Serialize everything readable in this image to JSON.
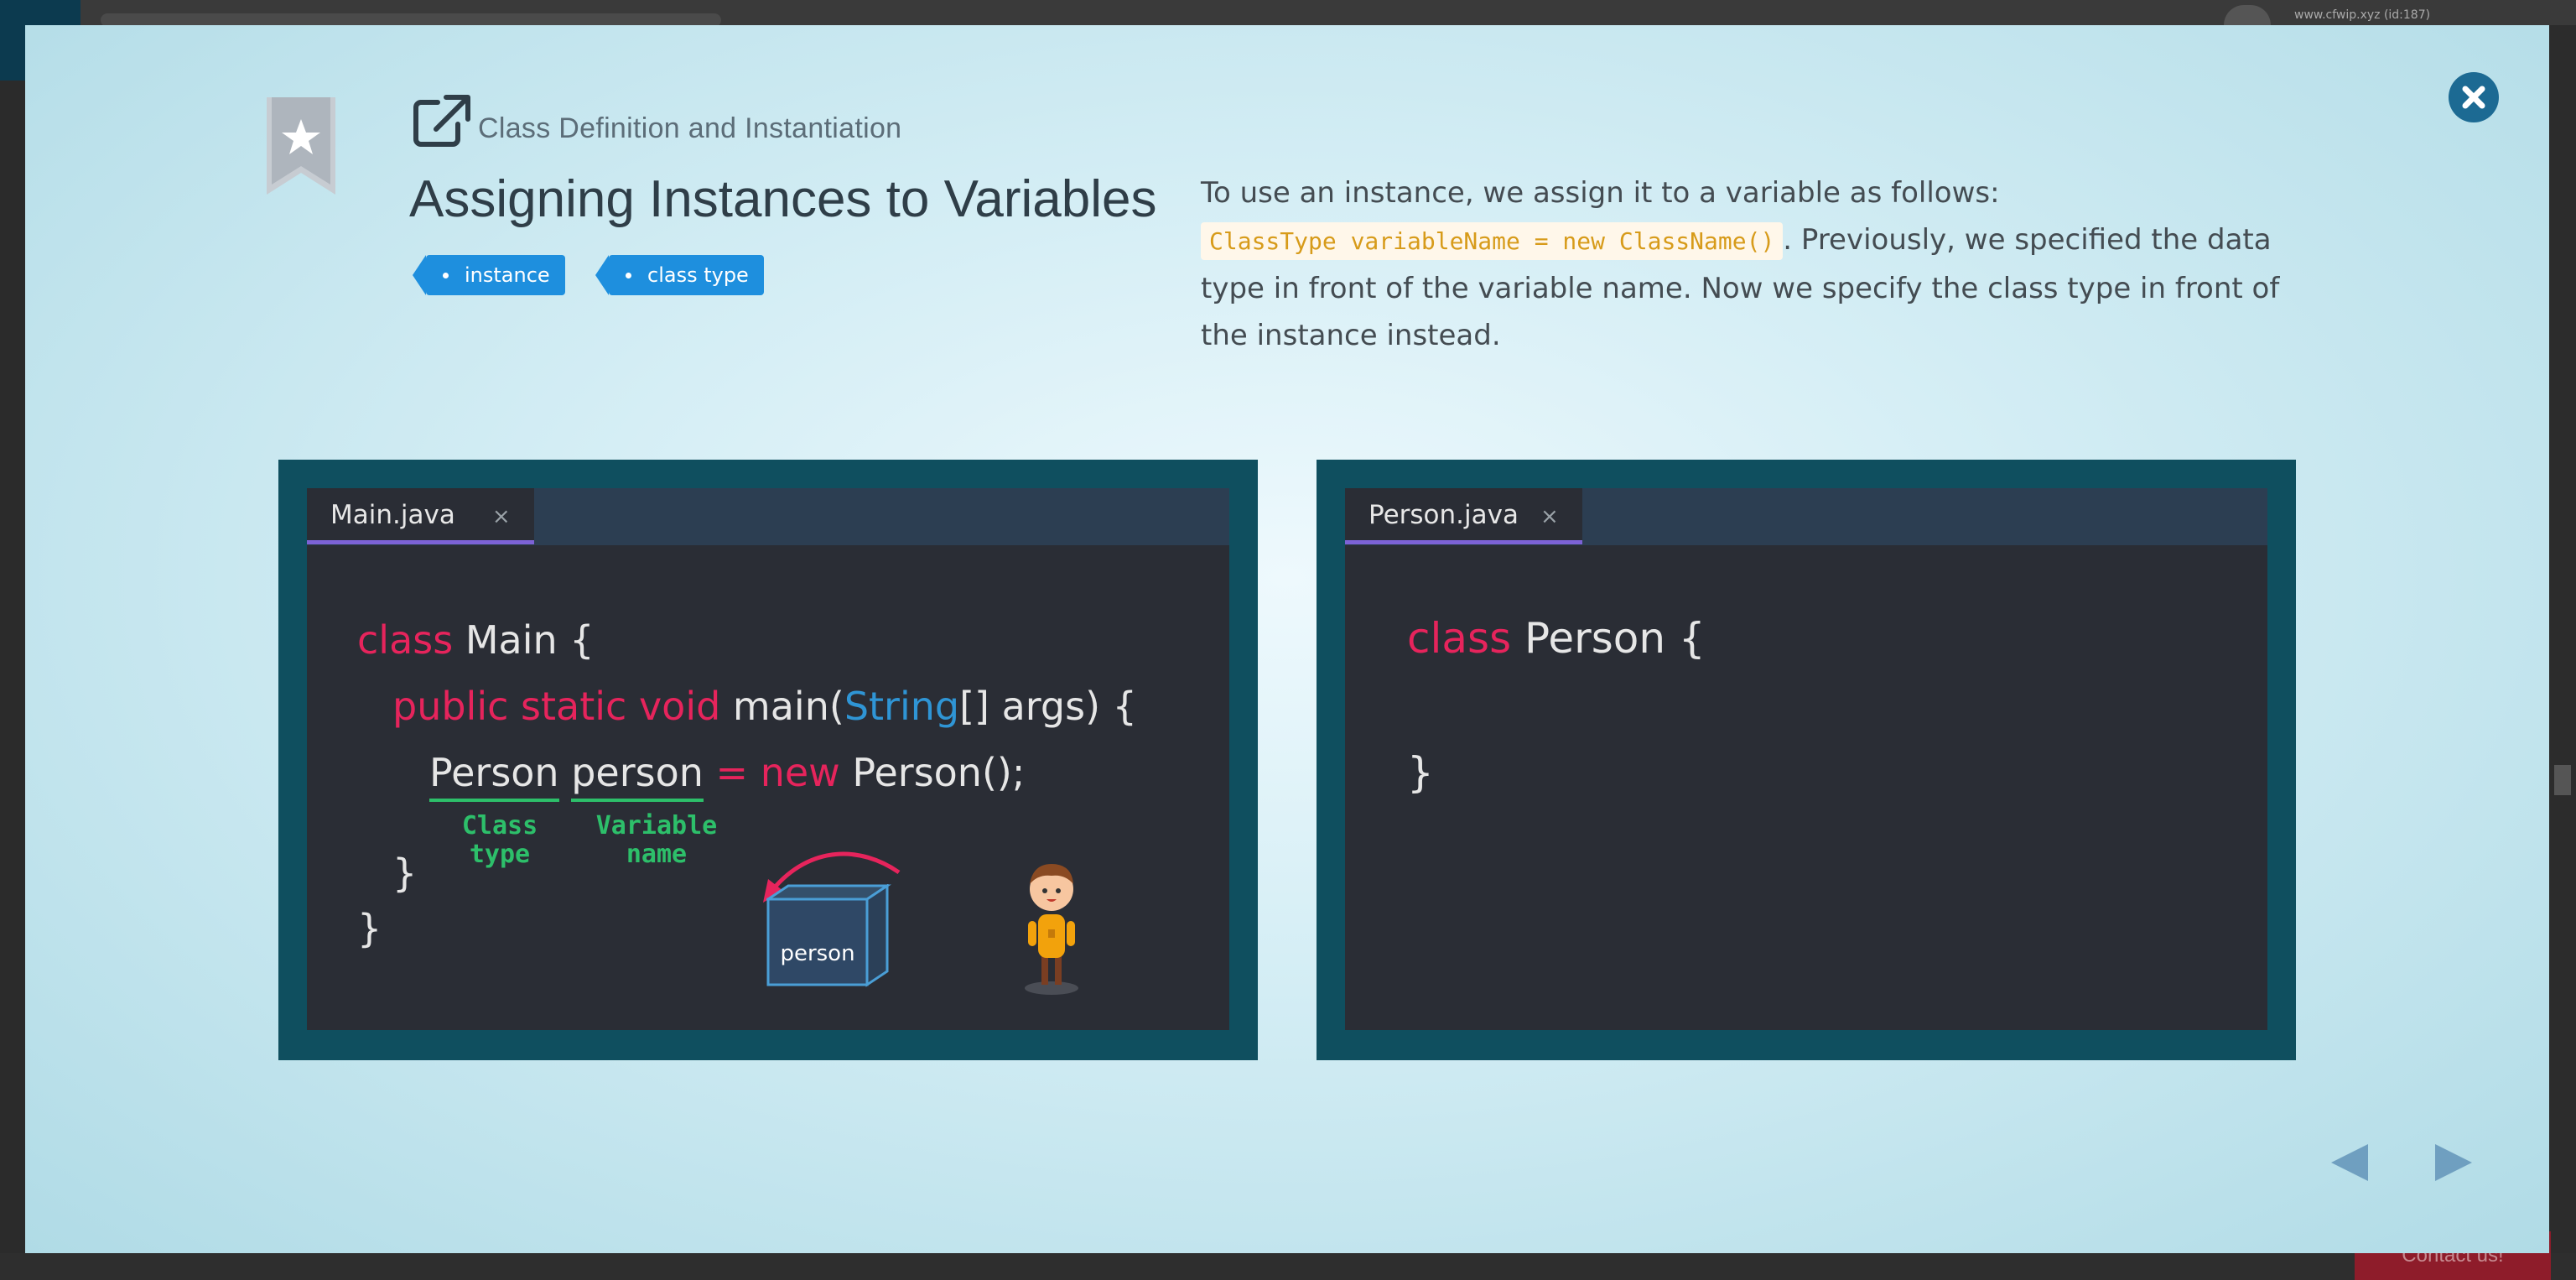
{
  "background": {
    "user_text": "www.cfwip.xyz (id:187)",
    "contact_label": "Contact us!"
  },
  "modal": {
    "subtitle": "Class Definition and Instantiation",
    "title": "Assigning Instances to Variables",
    "tags": [
      "instance",
      "class type"
    ],
    "description": {
      "intro": "To use an instance, we assign it to a variable as follows:",
      "code": "ClassType variableName = new ClassName()",
      "rest": ". Previously, we specified the data type in front of the variable name. Now we specify the class type in front of the instance instead."
    },
    "icons": {
      "bookmark": "bookmark-star-icon",
      "close": "close-icon",
      "external_link": "external-link-icon",
      "prev": "prev-arrow-icon",
      "next": "next-arrow-icon"
    },
    "colors": {
      "accent": "#1e8fde",
      "keyword": "#e6245c",
      "type": "#2f95d5",
      "annotation": "#2dbf6a"
    }
  },
  "main_editor": {
    "tab_label": "Main.java",
    "tab_close": "×",
    "lines": {
      "l1_kw": "class",
      "l1_rest": " Main {",
      "l2_kw": "public static void",
      "l2_mid": " main(",
      "l2_type": "String",
      "l2_rest": "[] args) {",
      "l3_type": "Person",
      "l3_var": "person",
      "l3_eq": "=",
      "l3_new": "new",
      "l3_rest": " Person();",
      "l4": "}",
      "l5": "}"
    },
    "annotations": {
      "class_type": "Class\ntype",
      "variable_name": "Variable\nname"
    },
    "box_label": "person"
  },
  "person_editor": {
    "tab_label": "Person.java",
    "tab_close": "×",
    "lines": {
      "l1_kw": "class",
      "l1_rest": " Person {",
      "l2": "}"
    }
  }
}
